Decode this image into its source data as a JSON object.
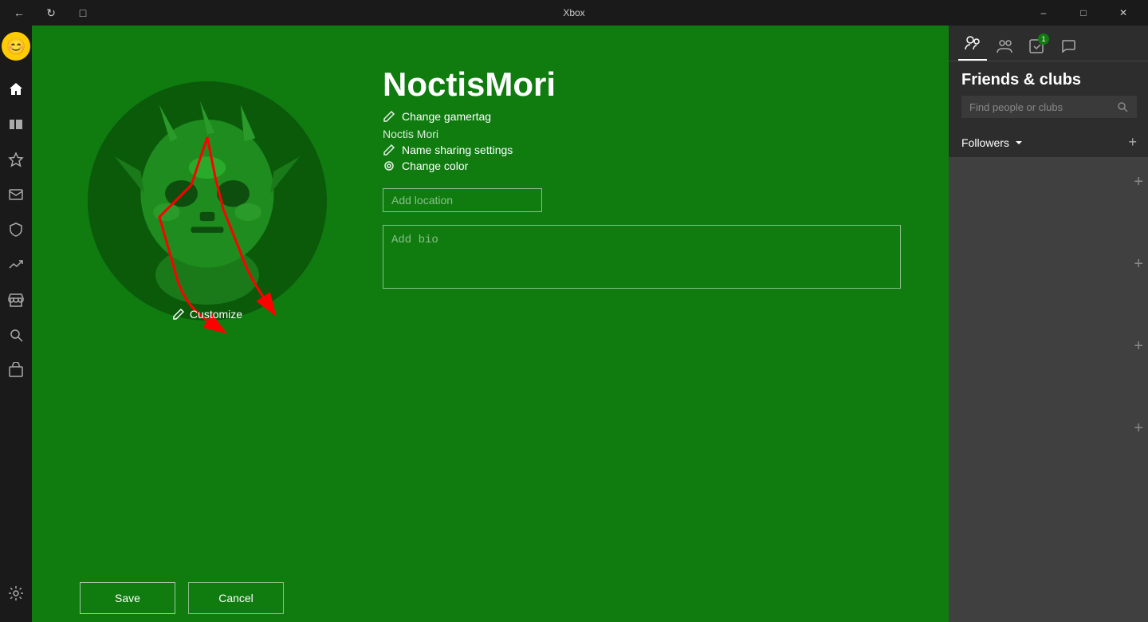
{
  "titlebar": {
    "back_icon": "←",
    "refresh_icon": "↻",
    "capture_icon": "⊡",
    "title": "Xbox",
    "minimize_icon": "─",
    "restore_icon": "□",
    "close_icon": "✕"
  },
  "sidebar": {
    "avatar_emoji": "😊",
    "items": [
      {
        "name": "home",
        "icon": "⌂"
      },
      {
        "name": "library",
        "icon": "▤"
      },
      {
        "name": "achievements",
        "icon": "⬡"
      },
      {
        "name": "messages",
        "icon": "⬚"
      },
      {
        "name": "shield",
        "icon": "◈"
      },
      {
        "name": "trending",
        "icon": "⟋"
      },
      {
        "name": "store",
        "icon": "⊞"
      },
      {
        "name": "search",
        "icon": "⌕"
      },
      {
        "name": "social",
        "icon": "⊟"
      },
      {
        "name": "settings",
        "icon": "⚙"
      }
    ]
  },
  "profile": {
    "gamertag": "NoctisMori",
    "real_name": "Noctis Mori",
    "change_gamertag_label": "Change gamertag",
    "name_sharing_label": "Name sharing settings",
    "change_color_label": "Change color",
    "customize_label": "Customize",
    "location_placeholder": "Add location",
    "bio_placeholder": "Add bio"
  },
  "bottom": {
    "save_label": "Save",
    "cancel_label": "Cancel"
  },
  "right_panel": {
    "title": "Friends & clubs",
    "search_placeholder": "Find people or clubs",
    "followers_label": "Followers",
    "badge_count": "1",
    "plus_labels": [
      "+",
      "+",
      "+",
      "+"
    ]
  }
}
